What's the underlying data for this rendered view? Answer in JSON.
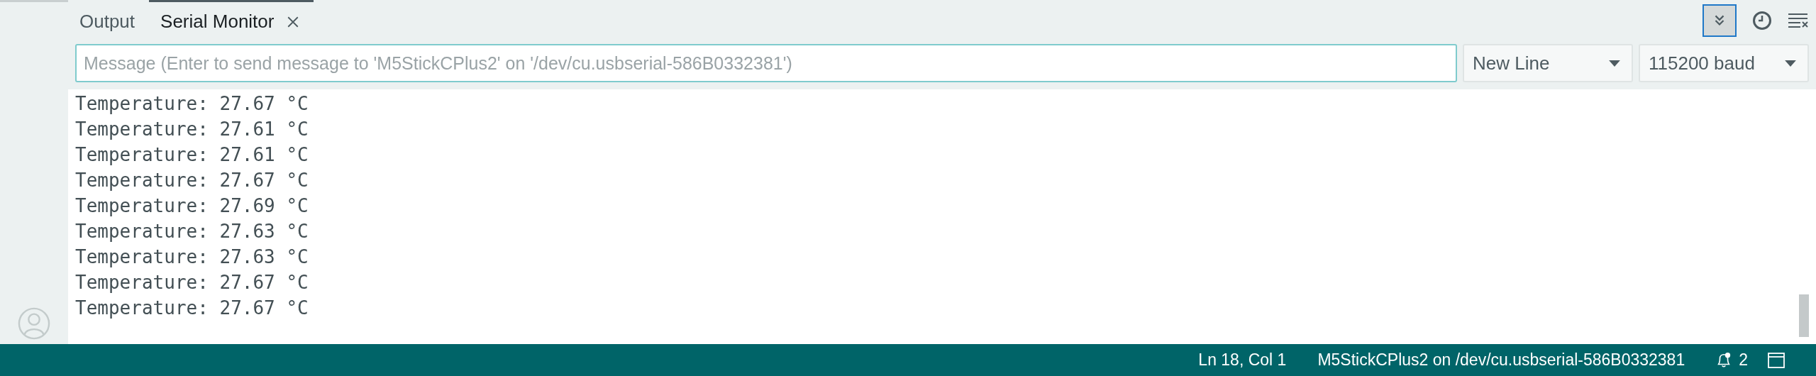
{
  "tabs": [
    {
      "label": "Output",
      "selected": false,
      "closable": false
    },
    {
      "label": "Serial Monitor",
      "selected": true,
      "closable": true
    }
  ],
  "toolbar": {
    "autoscroll_on": true
  },
  "message_field": {
    "placeholder": "Message (Enter to send message to 'M5StickCPlus2' on '/dev/cu.usbserial-586B0332381')"
  },
  "line_ending": {
    "value": "New Line"
  },
  "baud_rate": {
    "value": "115200 baud"
  },
  "log_lines": [
    "Temperature: 27.67 °C",
    "Temperature: 27.61 °C",
    "Temperature: 27.61 °C",
    "Temperature: 27.67 °C",
    "Temperature: 27.69 °C",
    "Temperature: 27.63 °C",
    "Temperature: 27.63 °C",
    "Temperature: 27.67 °C",
    "Temperature: 27.67 °C"
  ],
  "status_bar": {
    "cursor": "Ln 18, Col 1",
    "board": "M5StickCPlus2 on /dev/cu.usbserial-586B0332381",
    "notifications": "2"
  }
}
